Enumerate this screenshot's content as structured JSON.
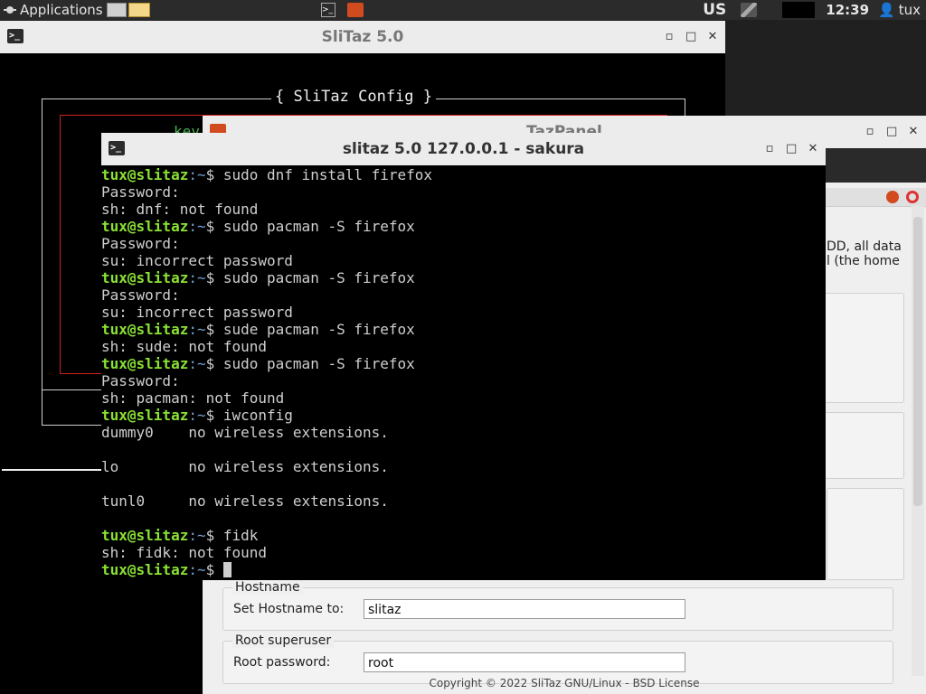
{
  "panel": {
    "applications": "Applications",
    "keyboard": "US",
    "clock": "12:39",
    "user": "tux"
  },
  "config_window": {
    "title": "SliTaz 5.0",
    "dialog_title": "{ SliTaz Config }",
    "partial_text": "key"
  },
  "tazpanel": {
    "title": "TazPanel",
    "desc_line1": "DD, all data",
    "desc_line2": "l (the home",
    "hostname_legend": "Hostname",
    "hostname_label": "Set Hostname to:",
    "hostname_value": "slitaz",
    "root_legend": "Root superuser",
    "root_label": "Root password:",
    "root_value": "root",
    "footer": "Copyright © 2022 SliTaz GNU/Linux - BSD License"
  },
  "terminal": {
    "title": "slitaz 5.0 127.0.0.1  - sakura",
    "prompt_user": "tux@slitaz",
    "prompt_path": ":~",
    "prompt_sym": "$ ",
    "lines": [
      {
        "type": "cmd",
        "text": "sudo dnf install firefox"
      },
      {
        "type": "out",
        "text": "Password:"
      },
      {
        "type": "out",
        "text": "sh: dnf: not found"
      },
      {
        "type": "cmd",
        "text": "sudo pacman -S firefox"
      },
      {
        "type": "out",
        "text": "Password:"
      },
      {
        "type": "out",
        "text": "su: incorrect password"
      },
      {
        "type": "cmd",
        "text": "sudo pacman -S firefox"
      },
      {
        "type": "out",
        "text": "Password:"
      },
      {
        "type": "out",
        "text": "su: incorrect password"
      },
      {
        "type": "cmd",
        "text": "sude pacman -S firefox"
      },
      {
        "type": "out",
        "text": "sh: sude: not found"
      },
      {
        "type": "cmd",
        "text": "sudo pacman -S firefox"
      },
      {
        "type": "out",
        "text": "Password:"
      },
      {
        "type": "out",
        "text": "sh: pacman: not found"
      },
      {
        "type": "cmd",
        "text": "iwconfig"
      },
      {
        "type": "out",
        "text": "dummy0    no wireless extensions."
      },
      {
        "type": "out",
        "text": ""
      },
      {
        "type": "out",
        "text": "lo        no wireless extensions."
      },
      {
        "type": "out",
        "text": ""
      },
      {
        "type": "out",
        "text": "tunl0     no wireless extensions."
      },
      {
        "type": "out",
        "text": ""
      },
      {
        "type": "cmd",
        "text": "fidk"
      },
      {
        "type": "out",
        "text": "sh: fidk: not found"
      },
      {
        "type": "cmd",
        "text": "",
        "cursor": true
      }
    ]
  },
  "window_controls": {
    "minimize": "▫",
    "maximize": "□",
    "close": "✕"
  },
  "icons": {
    "panel_menu": "spider-icon",
    "launcher_terminal": "terminal-icon",
    "launcher_tazpanel": "tazpanel-icon",
    "network": "network-icon",
    "user": "user-icon",
    "taskbar_files": "folder-icon"
  }
}
